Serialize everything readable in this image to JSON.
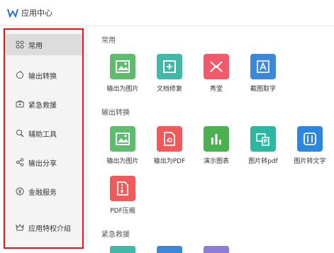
{
  "titlebar": {
    "title": "应用中心"
  },
  "sidebar": {
    "items": [
      {
        "label": "常用",
        "icon": "grid-icon"
      },
      {
        "label": "输出转换",
        "icon": "convert-icon"
      },
      {
        "label": "紧急救援",
        "icon": "first-aid-icon"
      },
      {
        "label": "辅助工具",
        "icon": "tools-icon"
      },
      {
        "label": "输出分享",
        "icon": "share-icon"
      },
      {
        "label": "金融服务",
        "icon": "finance-icon"
      },
      {
        "label": "应用特权介绍",
        "icon": "crown-icon"
      }
    ]
  },
  "sections": {
    "common": {
      "title": "常用",
      "apps": [
        {
          "label": "输出为图片",
          "color": "#5ebc6e"
        },
        {
          "label": "文档修复",
          "color": "#41b8a8"
        },
        {
          "label": "秀堂",
          "color": "#f05a6a"
        },
        {
          "label": "截图取字",
          "color": "#3b87d8"
        }
      ]
    },
    "convert": {
      "title": "输出转换",
      "apps": [
        {
          "label": "输出为图片",
          "color": "#5ebc6e"
        },
        {
          "label": "输出为PDF",
          "color": "#f05a5a"
        },
        {
          "label": "演示图表",
          "color": "#4caf50"
        },
        {
          "label": "图片转pdf",
          "color": "#2db7a3"
        },
        {
          "label": "图片转文字",
          "color": "#2e86de"
        },
        {
          "label": "PDF压缩",
          "color": "#f05a5a"
        }
      ]
    },
    "rescue": {
      "title": "紧急救援",
      "partial_colors": [
        "#41b8a8",
        "#3b87d8",
        "#8e7cd8"
      ]
    }
  }
}
